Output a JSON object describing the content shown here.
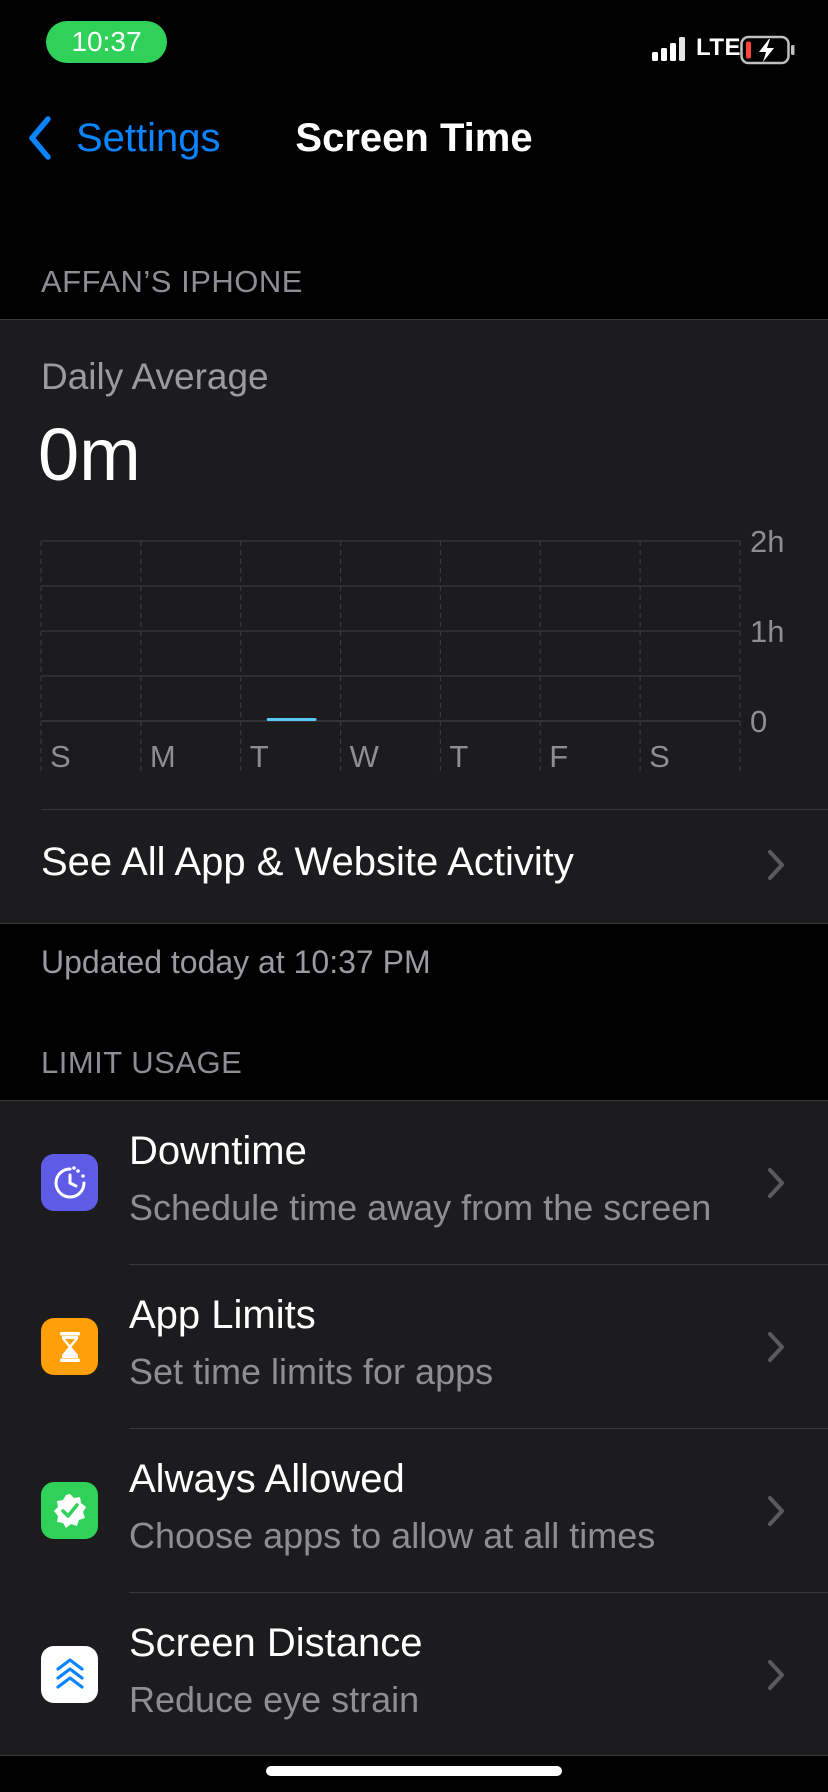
{
  "status_bar": {
    "time": "10:37",
    "network": "LTE",
    "signal_icon": "signal-bars-icon",
    "battery_icon": "battery-charging-icon",
    "pill_color": "#30d158"
  },
  "nav": {
    "back_label": "Settings",
    "title": "Screen Time",
    "accent_color": "#0a84ff"
  },
  "device_section": {
    "header": "AFFAN’S IPHONE",
    "daily_average_label": "Daily Average",
    "daily_average_value": "0m"
  },
  "chart_data": {
    "type": "bar",
    "categories": [
      "S",
      "M",
      "T",
      "W",
      "T",
      "F",
      "S"
    ],
    "values_minutes": [
      0,
      0,
      1,
      0,
      0,
      0,
      0
    ],
    "y_ticks": [
      "2h",
      "1h",
      "0"
    ],
    "ylim_hours": [
      0,
      2
    ],
    "bar_color": "#5ac8fa",
    "grid": true
  },
  "activity_row": {
    "label": "See All App & Website Activity"
  },
  "updated_text": "Updated today at 10:37 PM",
  "limit_section": {
    "header": "LIMIT USAGE",
    "items": [
      {
        "title": "Downtime",
        "subtitle": "Schedule time away from the screen",
        "icon": "downtime-icon",
        "icon_color": "#5e5ce6"
      },
      {
        "title": "App Limits",
        "subtitle": "Set time limits for apps",
        "icon": "hourglass-icon",
        "icon_color": "#ff9f0a"
      },
      {
        "title": "Always Allowed",
        "subtitle": "Choose apps to allow at all times",
        "icon": "checkmark-seal-icon",
        "icon_color": "#30d158"
      },
      {
        "title": "Screen Distance",
        "subtitle": "Reduce eye strain",
        "icon": "chevrons-up-icon",
        "icon_color": "#ffffff"
      }
    ]
  }
}
